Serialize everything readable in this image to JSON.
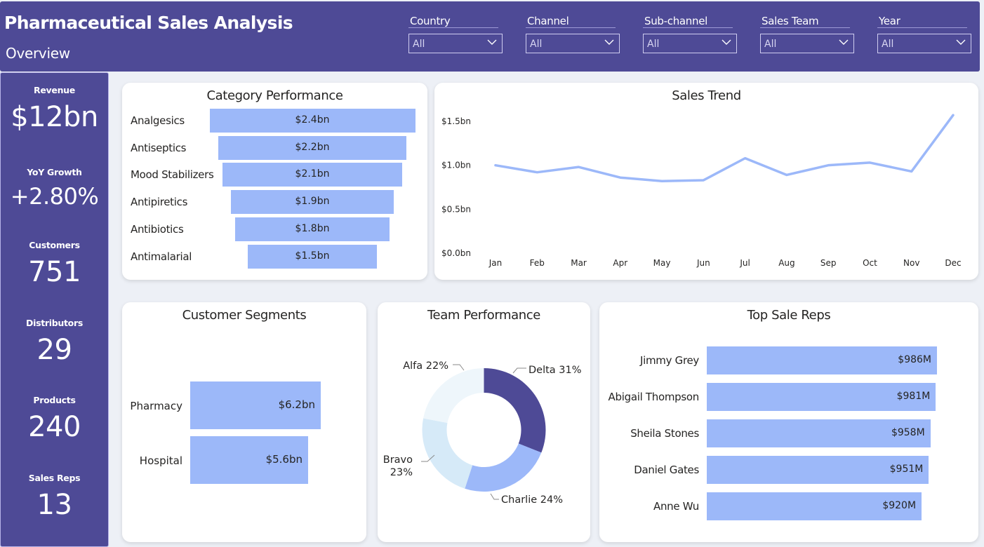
{
  "header": {
    "title": "Pharmaceutical Sales Analysis",
    "subtitle": "Overview",
    "filters": [
      {
        "label": "Country",
        "value": "All"
      },
      {
        "label": "Channel",
        "value": "All"
      },
      {
        "label": "Sub-channel",
        "value": "All"
      },
      {
        "label": "Sales Team",
        "value": "All"
      },
      {
        "label": "Year",
        "value": "All"
      }
    ]
  },
  "kpis": [
    {
      "label": "Revenue",
      "value": "$12bn"
    },
    {
      "label": "YoY Growth",
      "value": "+2.80%"
    },
    {
      "label": "Customers",
      "value": "751"
    },
    {
      "label": "Distributors",
      "value": "29"
    },
    {
      "label": "Products",
      "value": "240"
    },
    {
      "label": "Sales Reps",
      "value": "13"
    }
  ],
  "colors": {
    "brand": "#4e4a96",
    "bar": "#9cb8f9",
    "delta": "#4e4a96",
    "charlie": "#9cb8f9",
    "bravo": "#d6eaf8",
    "alfa": "#eef6fb"
  },
  "chart_data": [
    {
      "type": "bar",
      "title": "Category Performance",
      "categories": [
        "Analgesics",
        "Antiseptics",
        "Mood Stabilizers",
        "Antipiretics",
        "Antibiotics",
        "Antimalarial"
      ],
      "values": [
        2.4,
        2.2,
        2.1,
        1.9,
        1.8,
        1.5
      ],
      "labels": [
        "$2.4bn",
        "$2.2bn",
        "$2.1bn",
        "$1.9bn",
        "$1.8bn",
        "$1.5bn"
      ]
    },
    {
      "type": "line",
      "title": "Sales Trend",
      "x": [
        "Jan",
        "Feb",
        "Mar",
        "Apr",
        "May",
        "Jun",
        "Jul",
        "Aug",
        "Sep",
        "Oct",
        "Nov",
        "Dec"
      ],
      "values": [
        1.0,
        0.92,
        0.98,
        0.86,
        0.82,
        0.83,
        1.08,
        0.89,
        1.0,
        1.03,
        0.93,
        1.57
      ],
      "yticks": [
        {
          "value": 0.0,
          "label": "$0.0bn"
        },
        {
          "value": 0.5,
          "label": "$0.5bn"
        },
        {
          "value": 1.0,
          "label": "$1.0bn"
        },
        {
          "value": 1.5,
          "label": "$1.5bn"
        }
      ],
      "ylim": [
        0,
        1.5
      ]
    },
    {
      "type": "bar",
      "title": "Customer Segments",
      "categories": [
        "Pharmacy",
        "Hospital"
      ],
      "values": [
        6.2,
        5.6
      ],
      "labels": [
        "$6.2bn",
        "$5.6bn"
      ]
    },
    {
      "type": "pie",
      "title": "Team Performance",
      "slices": [
        {
          "name": "Delta",
          "value": 31,
          "label": "Delta 31%"
        },
        {
          "name": "Charlie",
          "value": 24,
          "label": "Charlie 24%"
        },
        {
          "name": "Bravo",
          "value": 23,
          "label1": "Bravo",
          "label2": "23%"
        },
        {
          "name": "Alfa",
          "value": 22,
          "label": "Alfa 22%"
        }
      ]
    },
    {
      "type": "bar",
      "title": "Top Sale Reps",
      "categories": [
        "Jimmy Grey",
        "Abigail Thompson",
        "Sheila Stones",
        "Daniel Gates",
        "Anne Wu"
      ],
      "values": [
        986,
        981,
        958,
        951,
        920
      ],
      "labels": [
        "$986M",
        "$981M",
        "$958M",
        "$951M",
        "$920M"
      ]
    }
  ]
}
